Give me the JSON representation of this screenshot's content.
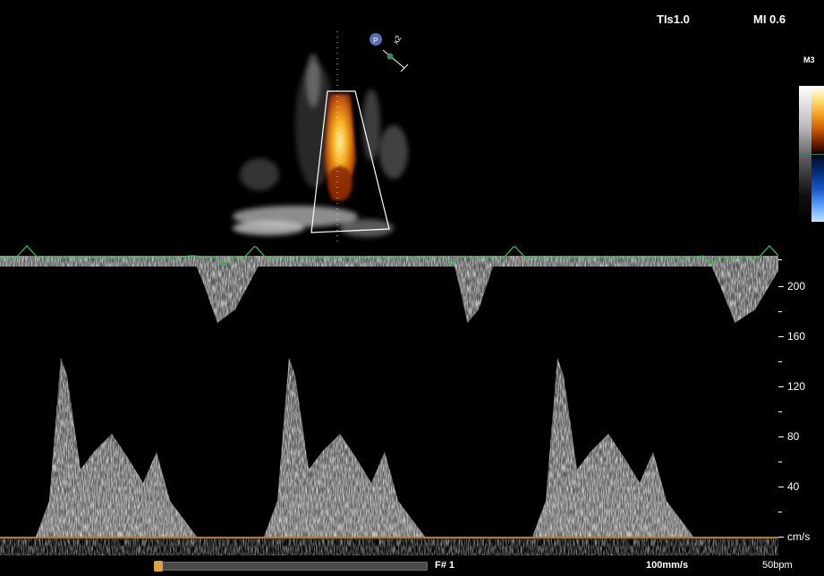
{
  "header": {
    "tis": "TIs1.0",
    "mi": "MI 0.6"
  },
  "colormap": {
    "label": "M3"
  },
  "probe": {
    "zoom_label": "x2",
    "marker": "P"
  },
  "velocity_scale": {
    "ticks": [
      "200",
      "160",
      "120",
      "80",
      "40",
      "cm/s"
    ],
    "tick_values": [
      200,
      160,
      120,
      80,
      40,
      0
    ]
  },
  "footer": {
    "frame": "F#  1",
    "sweep_speed": "100mm/s",
    "heart_rate": "50bpm"
  },
  "colors": {
    "ecg": "#3fbf5a",
    "baseline": "#b07a30",
    "color_flow_hot": "#f59a1c",
    "color_flow_cool": "#1a55c8"
  }
}
